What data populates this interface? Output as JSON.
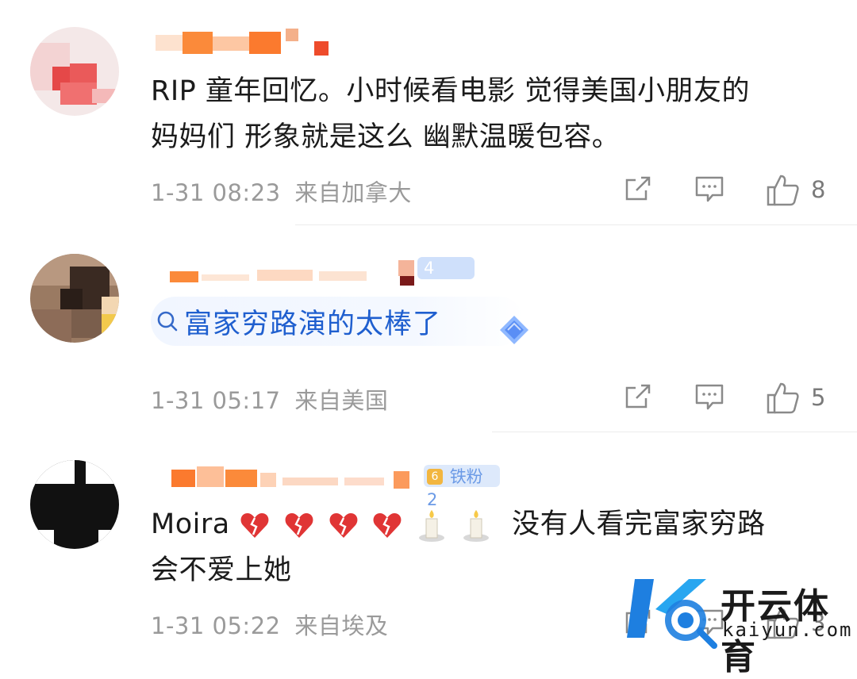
{
  "comments": [
    {
      "text_lines": [
        "RIP 童年回忆。小时候看电影 觉得美国小朋友的",
        "妈妈们 形象就是这么 幽默温暖包容。"
      ],
      "date": "1-31 08:23",
      "location": "来自加拿大",
      "likes": "8"
    },
    {
      "search_label": "富家穷路演的太棒了",
      "badge": "4",
      "date": "1-31 05:17",
      "location": "来自美国",
      "likes": "5"
    },
    {
      "text_start": "Moira",
      "text_rest": "没有人看完富家穷路",
      "text_line2": "会不爱上她",
      "badge_level": "6",
      "badge_fan": "铁粉2",
      "date": "1-31 05:22",
      "location": "来自埃及",
      "likes": "3"
    }
  ],
  "icons": [
    "share-icon",
    "comment-icon",
    "like-icon",
    "search-icon",
    "broken-heart-icon",
    "candle-icon"
  ],
  "watermark": {
    "title": "开云体育",
    "subtitle": "kaiyun.com"
  },
  "colors": {
    "link_blue": "#1f5fcf",
    "meta_gray": "#9a9a9a",
    "heart_red": "#e03535"
  }
}
